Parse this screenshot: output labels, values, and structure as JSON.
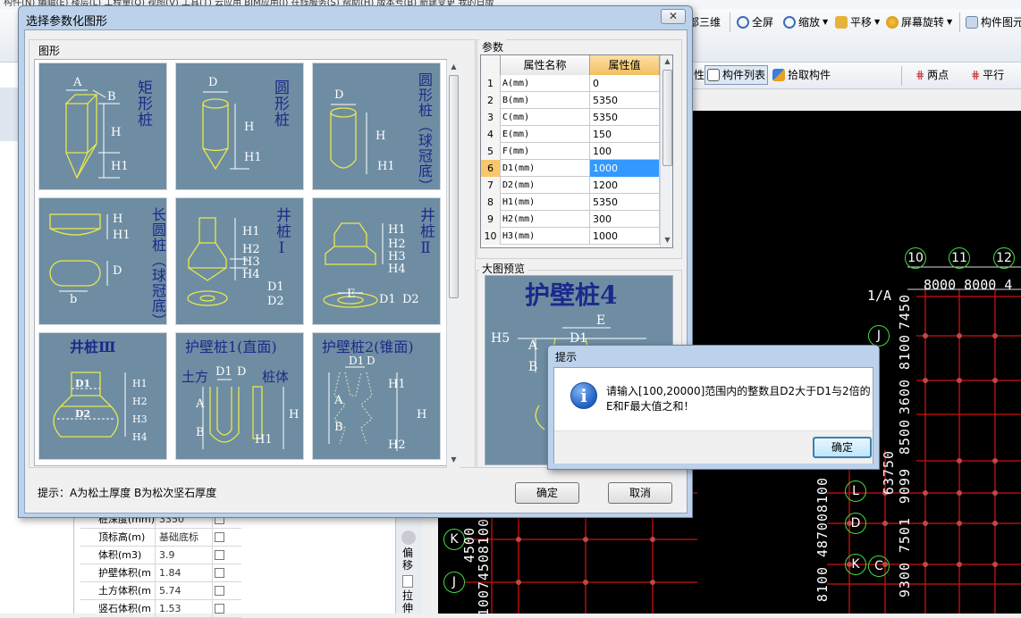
{
  "app": {
    "menu_text": "构件(N)  编辑(E)  楼层(L)  工程量(Q)  视图(V)  工具(T)  云应用  BIM应用(I)  在线服务(S)  帮助(H)  版本号(B)  新建变更  我的日版",
    "toolbar": [
      {
        "label": "部三维",
        "icon": "3d-view-icon"
      },
      {
        "label": "全屏",
        "icon": "zoom-fullscreen-icon"
      },
      {
        "label": "缩放",
        "icon": "zoom-icon"
      },
      {
        "label": "平移",
        "icon": "pan-icon"
      },
      {
        "label": "屏幕旋转",
        "icon": "rotate-icon"
      },
      {
        "label": "构件图元",
        "icon": "component-icon"
      }
    ],
    "toolbar2": [
      {
        "label": "性"
      },
      {
        "label": "构件列表",
        "icon": "list-icon"
      },
      {
        "label": "拾取构件",
        "icon": "pick-icon"
      },
      {
        "label": "两点",
        "icon": "two-point-icon"
      },
      {
        "label": "平行",
        "icon": "parallel-icon"
      }
    ],
    "side_tools": [
      {
        "label": "偏移"
      },
      {
        "label": "拉伸"
      }
    ],
    "properties": [
      {
        "name": "桩深度(mm)",
        "value": "3350"
      },
      {
        "name": "顶标高(m)",
        "value": "基础底标"
      },
      {
        "name": "体积(m3)",
        "value": "3.9"
      },
      {
        "name": "护壁体积(m",
        "value": "1.84"
      },
      {
        "name": "土方体积(m",
        "value": "5.74"
      },
      {
        "name": "竖石体积(m",
        "value": "1.53"
      }
    ],
    "grid_labels": {
      "cols": [
        "10",
        "11",
        "12"
      ],
      "rows": [
        "J",
        "K",
        "L",
        "D",
        "C"
      ],
      "spacing_top": "8000 8000 4",
      "left_partial": "1/A",
      "vertical_dims": [
        "7450",
        "8100",
        "8100",
        "3600",
        "8500",
        "9099",
        "7501",
        "9300"
      ],
      "bottom_dims": [
        "8100",
        "48700",
        "8100",
        "8100",
        "4500",
        "8100",
        "7450",
        "63750"
      ]
    }
  },
  "dialog": {
    "title": "选择参数化图形",
    "close_label": "✕",
    "shapes_group": "图形",
    "shapes": [
      {
        "title": "矩形桩",
        "labels": [
          "A",
          "B",
          "H",
          "H1"
        ]
      },
      {
        "title": "圆形桩",
        "labels": [
          "D",
          "H",
          "H1"
        ]
      },
      {
        "title": "圆形桩（球冠底）",
        "labels": [
          "D",
          "H",
          "H1"
        ]
      },
      {
        "title": "长圆桩（球冠底）",
        "labels": [
          "H",
          "H1",
          "D",
          "b"
        ]
      },
      {
        "title": "井桩Ⅰ",
        "labels": [
          "H1",
          "H2",
          "H3",
          "H4",
          "D1",
          "D2"
        ]
      },
      {
        "title": "井桩Ⅱ",
        "labels": [
          "H1",
          "H2",
          "H3",
          "H4",
          "E",
          "D1",
          "D2"
        ]
      },
      {
        "title": "井桩Ⅲ",
        "labels": [
          "D1",
          "D2",
          "H1",
          "H2",
          "H3",
          "H4"
        ]
      },
      {
        "title": "护壁桩1(直面)",
        "labels": [
          "土方",
          "D1",
          "D",
          "桩体",
          "A",
          "B",
          "H",
          "H1"
        ]
      },
      {
        "title": "护壁桩2(锥面)",
        "labels": [
          "D1",
          "D",
          "H1",
          "A",
          "B",
          "H",
          "H2"
        ]
      }
    ],
    "params_group": "参数",
    "table": {
      "headers": [
        "属性名称",
        "属性值"
      ],
      "rows": [
        {
          "no": "1",
          "name": "A(mm)",
          "value": "0"
        },
        {
          "no": "2",
          "name": "B(mm)",
          "value": "5350"
        },
        {
          "no": "3",
          "name": "C(mm)",
          "value": "5350"
        },
        {
          "no": "4",
          "name": "E(mm)",
          "value": "150"
        },
        {
          "no": "5",
          "name": "F(mm)",
          "value": "100"
        },
        {
          "no": "6",
          "name": "D1(mm)",
          "value": "1000"
        },
        {
          "no": "7",
          "name": "D2(mm)",
          "value": "1200"
        },
        {
          "no": "8",
          "name": "H1(mm)",
          "value": "5350"
        },
        {
          "no": "9",
          "name": "H2(mm)",
          "value": "300"
        },
        {
          "no": "10",
          "name": "H3(mm)",
          "value": "1000"
        }
      ],
      "selected_row": 6
    },
    "preview_group": "大图预览",
    "preview_title": "护壁桩4",
    "preview_labels": [
      "H5",
      "A",
      "B",
      "D1",
      "E"
    ],
    "hint": "提示：A为松土厚度  B为松次坚石厚度",
    "ok_label": "确定",
    "cancel_label": "取消"
  },
  "alert": {
    "title": "提示",
    "icon": "info-icon",
    "message": "请输入[100,20000]范围内的整数且D2大于D1与2倍的E和F最大值之和！",
    "ok_label": "确定"
  },
  "colors": {
    "tile_bg": "#6e8da3",
    "title_blue": "#1b2a8a",
    "grid_red": "#d01010",
    "bubble_green": "#3fe03f",
    "selection": "#3399ff",
    "header_orange": "#f7c86b"
  }
}
